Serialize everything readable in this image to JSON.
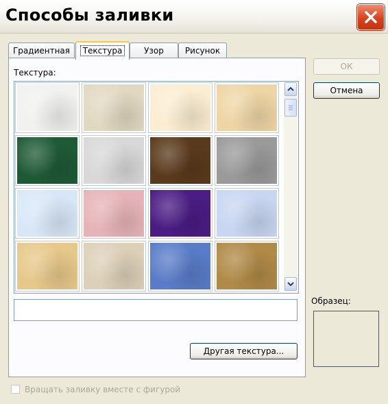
{
  "window": {
    "title": "Способы заливки"
  },
  "tabs": [
    {
      "label": "Градиентная",
      "active": false
    },
    {
      "label": "Текстура",
      "active": true
    },
    {
      "label": "Узор",
      "active": false
    },
    {
      "label": "Рисунок",
      "active": false
    }
  ],
  "texture_section": {
    "label": "Текстура:",
    "name_value": ""
  },
  "textures": [
    {
      "name": "white-marble-paper",
      "color": "#f1f1ef"
    },
    {
      "name": "beige-recycled-paper",
      "color": "#e2d8c2"
    },
    {
      "name": "cream-parchment",
      "color": "#fbedd2"
    },
    {
      "name": "tan-sand",
      "color": "#eed5a6"
    },
    {
      "name": "green-marble",
      "color": "#1f5a36"
    },
    {
      "name": "white-gray-marble",
      "color": "#d8d8d8"
    },
    {
      "name": "brown-marble",
      "color": "#5a3a1c"
    },
    {
      "name": "granite",
      "color": "#9a9a9a"
    },
    {
      "name": "light-blue-paper",
      "color": "#d8e7f7"
    },
    {
      "name": "pink-tissue",
      "color": "#e6b4b8"
    },
    {
      "name": "purple-mesh",
      "color": "#4a1c84"
    },
    {
      "name": "bouquet-lavender",
      "color": "#c8d6f2"
    },
    {
      "name": "papyrus",
      "color": "#e6c88a"
    },
    {
      "name": "canvas",
      "color": "#dcd0b8"
    },
    {
      "name": "denim",
      "color": "#5a7cc8"
    },
    {
      "name": "woven-mat",
      "color": "#b08a48"
    }
  ],
  "buttons": {
    "ok": "ОК",
    "cancel": "Отмена",
    "other_texture": "Другая текстура..."
  },
  "sample": {
    "label": "Образец:"
  },
  "rotate_checkbox": {
    "label": "Вращать заливку вместе с фигурой",
    "checked": false,
    "enabled": false
  }
}
